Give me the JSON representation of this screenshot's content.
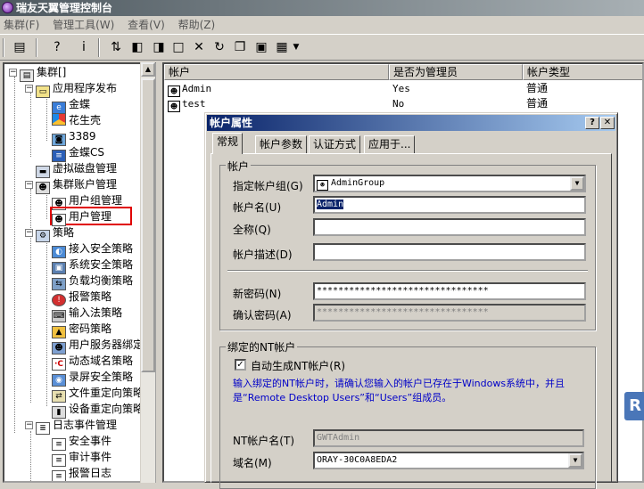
{
  "window": {
    "title": "瑞友天翼管理控制台"
  },
  "menubar": [
    "集群(F)",
    "管理工具(W)",
    "查看(V)",
    "帮助(Z)"
  ],
  "tree": {
    "root": "集群[]",
    "app_publish": "应用程序发布",
    "apps": [
      "金蝶",
      "花生壳",
      "3389",
      "金蝶CS"
    ],
    "virtual_disk": "虚拟磁盘管理",
    "account_mgmt": "集群账户管理",
    "group_mgmt": "用户组管理",
    "user_mgmt": "用户管理",
    "policy": "策略",
    "policies": [
      "接入安全策略",
      "系统安全策略",
      "负载均衡策略",
      "报警策略",
      "输入法策略",
      "密码策略",
      "用户服务器绑定",
      "动态域名策略",
      "录屏安全策略",
      "文件重定向策略",
      "设备重定向策略"
    ],
    "log_mgmt": "日志事件管理",
    "logs": [
      "安全事件",
      "审计事件",
      "报警日志"
    ]
  },
  "list": {
    "columns": [
      "帐户",
      "是否为管理员",
      "帐户类型"
    ],
    "rows": [
      {
        "name": "Admin",
        "admin": "Yes",
        "type": "普通"
      },
      {
        "name": "test",
        "admin": "No",
        "type": "普通"
      }
    ]
  },
  "side_badge": "R",
  "dialog": {
    "title": "帐户属性",
    "help_btn": "?",
    "close_btn": "✕",
    "tabs": [
      "常规",
      "帐户参数",
      "认证方式",
      "应用于..."
    ],
    "account_group_title": "帐户",
    "group_label": "指定帐户组(G)",
    "group_value": "AdminGroup",
    "name_label": "帐户名(U)",
    "name_value": "Admin",
    "fullname_label": "全称(Q)",
    "fullname_value": "",
    "desc_label": "帐户描述(D)",
    "desc_value": "",
    "newpwd_label": "新密码(N)",
    "newpwd_value": "********************************",
    "confirm_label": "确认密码(A)",
    "confirm_value": "********************************",
    "nt_group_title": "绑定的NT帐户",
    "auto_nt_label": "自动生成NT帐户(R)",
    "auto_nt_checked": "✓",
    "info_line1": "输入绑定的NT帐户时，请确认您输入的帐户已存在于Windows系统中，并且",
    "info_line2": "是“Remote Desktop Users”和“Users”组成员。",
    "nt_name_label": "NT帐户名(T)",
    "nt_name_value": "GWTAdmin",
    "domain_label": "域名(M)",
    "domain_value": "ORAY-30C0A8EDA2"
  }
}
